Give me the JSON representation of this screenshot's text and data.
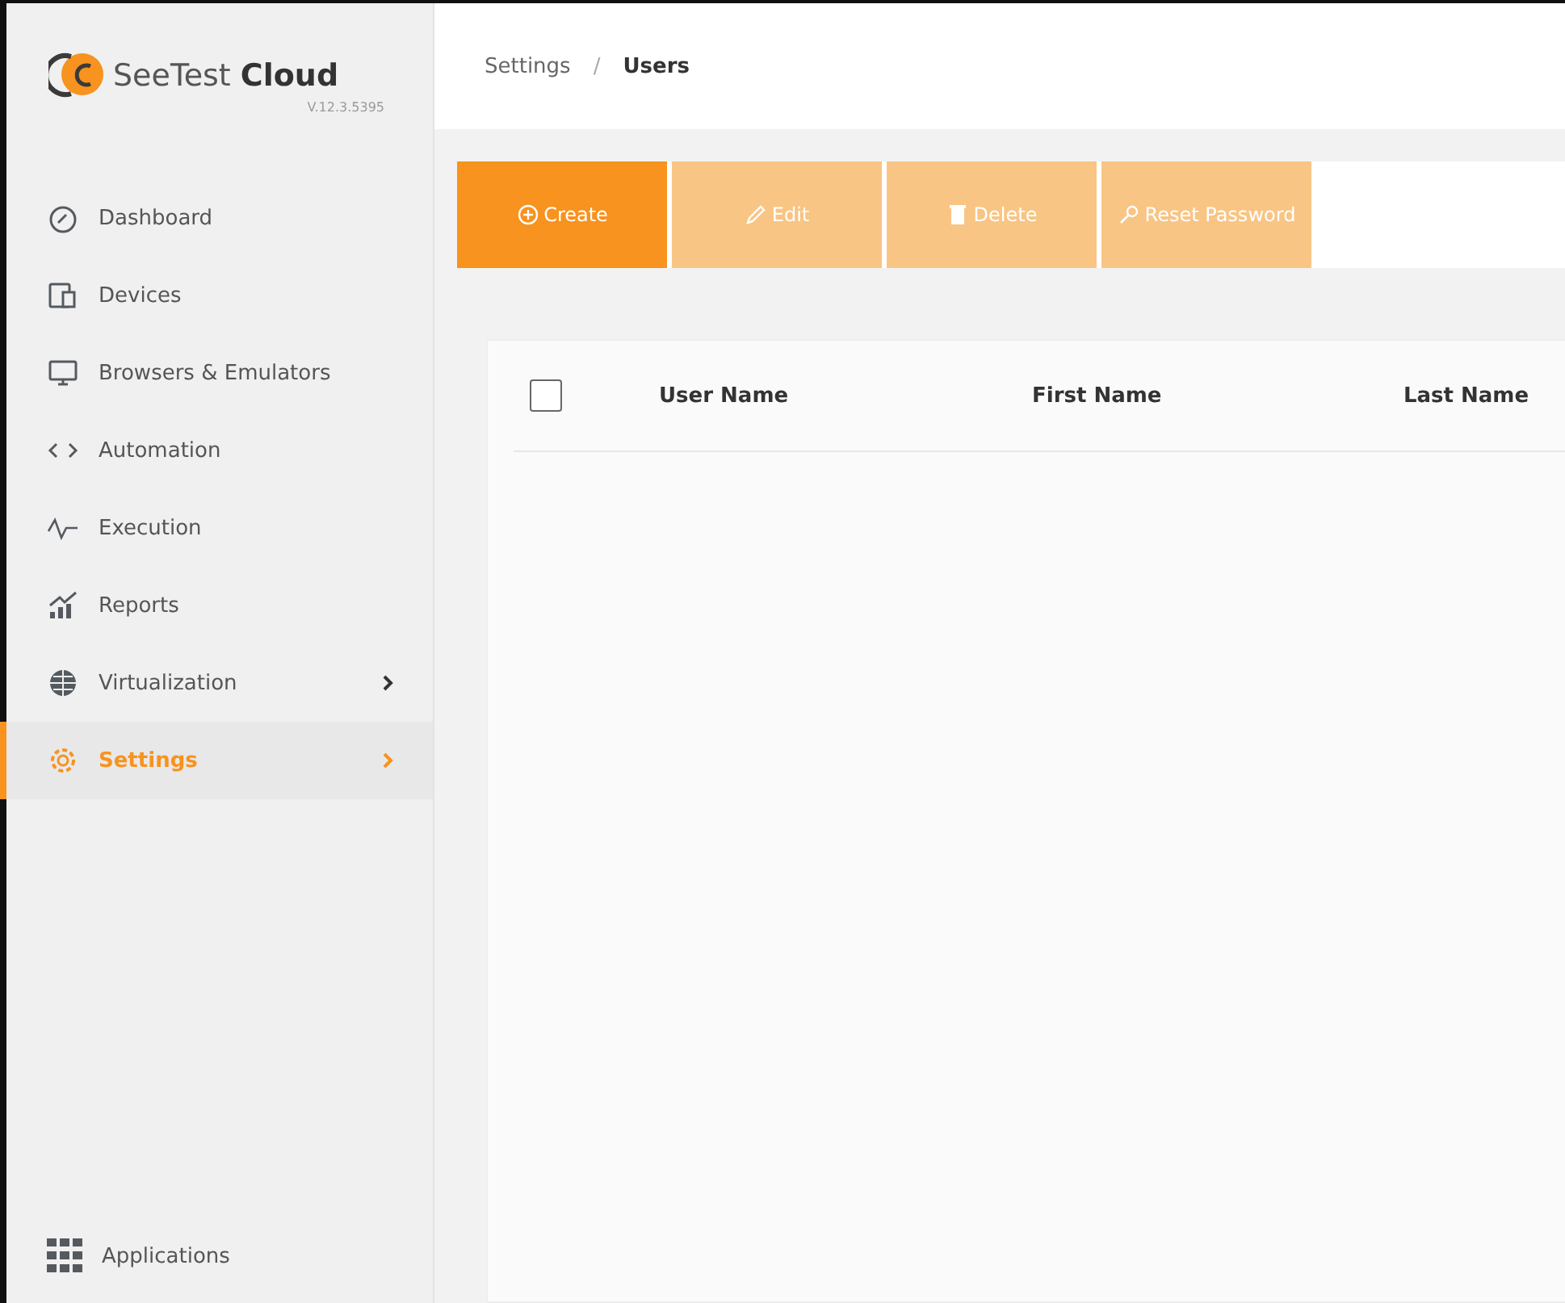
{
  "sidebar": {
    "logo": {
      "brand": "SeeTest",
      "product": "Cloud",
      "version": "V.12.3.5395"
    },
    "items": [
      {
        "label": "Dashboard",
        "selected": false,
        "has_submenu": false
      },
      {
        "label": "Devices",
        "selected": false,
        "has_submenu": false
      },
      {
        "label": "Browsers & Emulators",
        "selected": false,
        "has_submenu": false
      },
      {
        "label": "Automation",
        "selected": false,
        "has_submenu": false
      },
      {
        "label": "Execution",
        "selected": false,
        "has_submenu": false
      },
      {
        "label": "Reports",
        "selected": false,
        "has_submenu": false
      },
      {
        "label": "Virtualization",
        "selected": false,
        "has_submenu": true
      },
      {
        "label": "Settings",
        "selected": true,
        "has_submenu": true
      }
    ],
    "footer": {
      "label": "Applications"
    }
  },
  "breadcrumb": [
    {
      "label": "Settings"
    },
    {
      "label": "Users"
    }
  ],
  "breadcrumb_separator": "/",
  "toolbar": [
    {
      "label": "Create",
      "disabled": false
    },
    {
      "label": "Edit",
      "disabled": true
    },
    {
      "label": "Delete",
      "disabled": true
    },
    {
      "label": "Reset Password",
      "disabled": true
    }
  ],
  "table": {
    "select_all": {
      "checked": false
    },
    "columns": [
      "User Name",
      "First Name",
      "Last Name"
    ]
  }
}
